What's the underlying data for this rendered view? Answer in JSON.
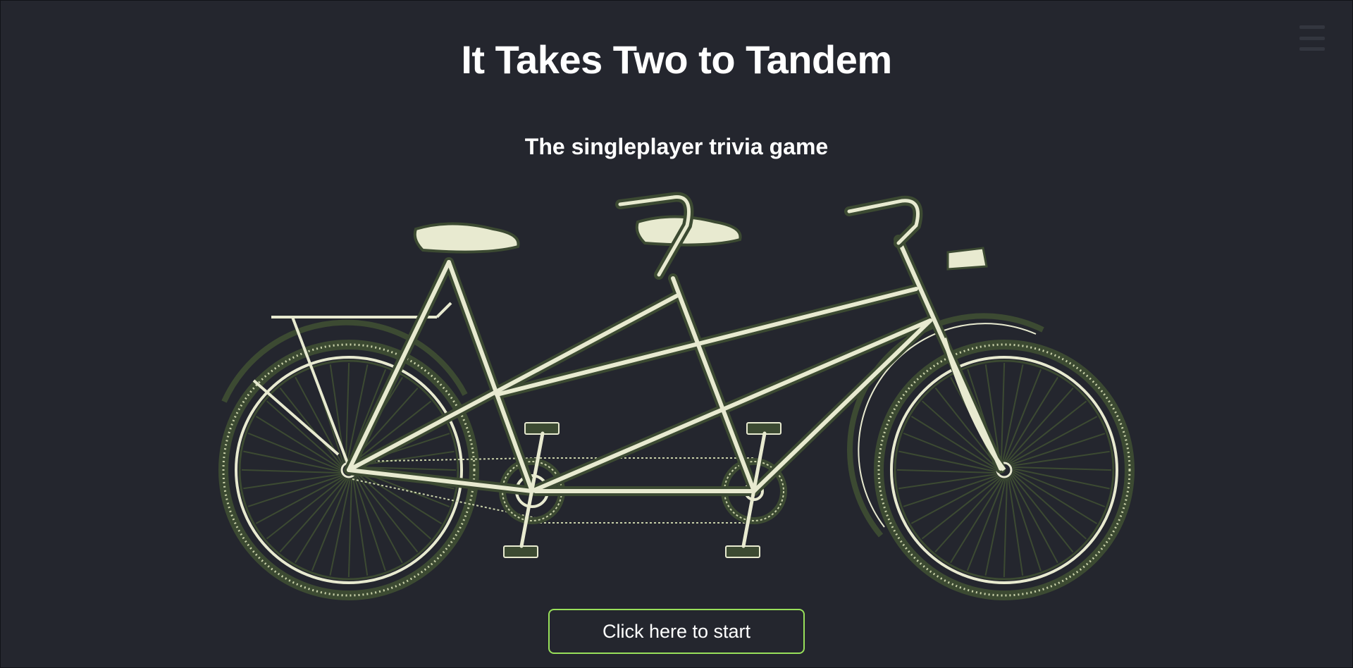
{
  "page": {
    "title": "It Takes Two to Tandem",
    "subtitle": "The singleplayer trivia game"
  },
  "start_button": {
    "label": "Click here to start"
  },
  "menu": {
    "icon": "hamburger-menu-icon"
  },
  "colors": {
    "background": "#24262e",
    "accent": "#98e05a",
    "bike_dark": "#3c4a32",
    "bike_light": "#e8ead0"
  },
  "illustration": {
    "icon": "tandem-bicycle-illustration"
  }
}
